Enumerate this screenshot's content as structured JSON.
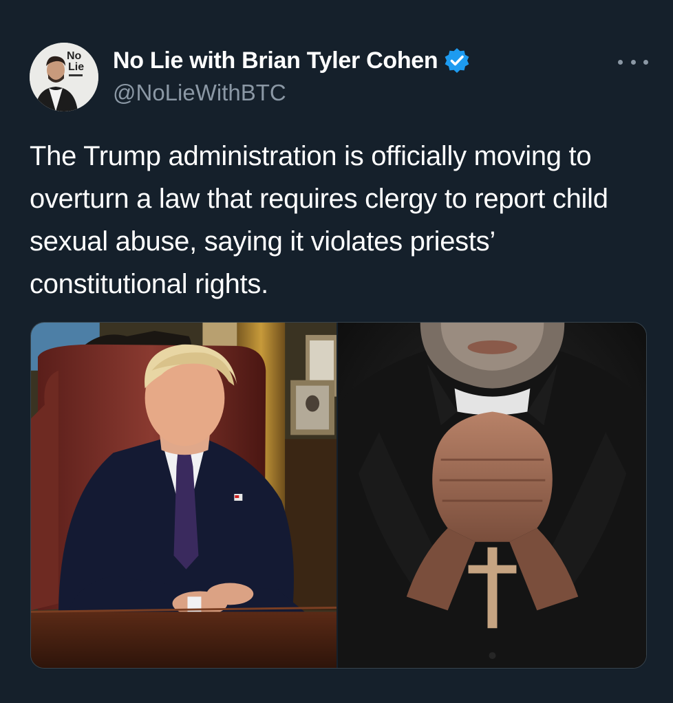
{
  "author": {
    "display_name": "No Lie with Brian Tyler Cohen",
    "handle": "@NoLieWithBTC",
    "verified": true,
    "avatar_logo_lines": [
      "No",
      "Lie"
    ]
  },
  "tweet": {
    "text": "The Trump administration is officially moving to overturn a law that requires clergy to report child sexual abuse, saying it violates priests’ constitutional rights."
  },
  "media": {
    "count": 2,
    "items": [
      "photo-politician-at-desk",
      "photo-priest-praying-with-cross"
    ]
  },
  "icons": {
    "verified": "verified-badge-icon",
    "more": "more-options-icon"
  },
  "colors": {
    "background": "#15202b",
    "text_primary": "#ffffff",
    "text_secondary": "#8b98a5",
    "verified_blue": "#1d9bf0",
    "border": "#38444d"
  }
}
